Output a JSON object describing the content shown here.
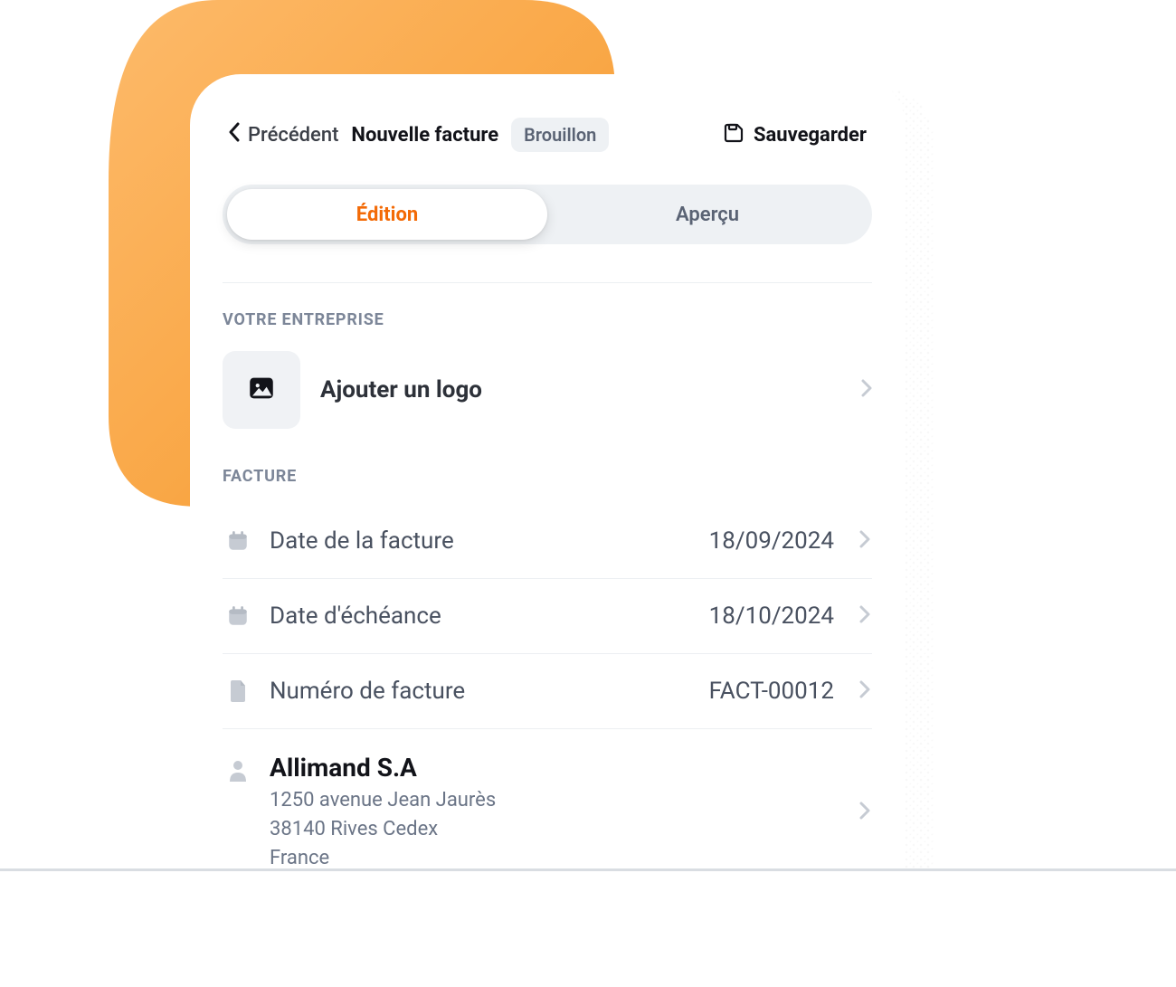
{
  "header": {
    "back_label": "Précédent",
    "title": "Nouvelle facture",
    "badge": "Brouillon",
    "save_label": "Sauvegarder"
  },
  "tabs": {
    "edit": "Édition",
    "preview": "Aperçu"
  },
  "sections": {
    "company_heading": "VOTRE ENTREPRISE",
    "add_logo": "Ajouter un logo",
    "invoice_heading": "FACTURE"
  },
  "invoice": {
    "invoice_date_label": "Date de la facture",
    "invoice_date_value": "18/09/2024",
    "due_date_label": "Date d'échéance",
    "due_date_value": "18/10/2024",
    "number_label": "Numéro de facture",
    "number_value": "FACT-00012"
  },
  "client": {
    "name": "Allimand S.A",
    "address_line1": "1250 avenue Jean Jaurès",
    "address_line2": "38140 Rives Cedex",
    "country": "France"
  },
  "colors": {
    "accent": "#F36A06",
    "muted": "#7c8698"
  }
}
